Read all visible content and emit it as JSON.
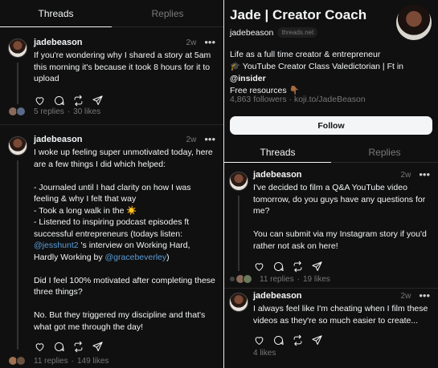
{
  "left_panel": {
    "tabs": [
      {
        "label": "Threads",
        "active": true
      },
      {
        "label": "Replies",
        "active": false
      }
    ],
    "posts": [
      {
        "username": "jadebeason",
        "time": "2w",
        "text": "If you're wondering why I shared a story at 5am this morning it's because it took 8 hours for it to upload",
        "replies": "5 replies",
        "likes": "30 likes"
      },
      {
        "username": "jadebeason",
        "time": "2w",
        "text_lines": {
          "l1": "I woke up feeling super unmotivated today, here are a few things I did which helped:",
          "l2": "- Journaled until I had clarity on how I was feeling & why I felt that way",
          "l3": "- Took a long walk in the ☀️",
          "l4": "- Listened to inspiring podcast episodes ft successful entrepreneurs (todays listen: ",
          "m1": "@jesshunt2",
          "l5": " 's interview on Working Hard, Hardly Working by ",
          "m2": "@gracebeverley",
          "l6": ")",
          "l7": "Did I feel 100% motivated after completing these three things?",
          "l8": "No. But they triggered my discipline and that's what got me through the day!"
        },
        "replies": "11 replies",
        "likes": "149 likes"
      }
    ],
    "stat_separator": "·"
  },
  "right_panel": {
    "profile": {
      "name": "Jade | Creator Coach",
      "handle": "jadebeason",
      "badge": "threads.net",
      "bio_line1": "Life as a full time creator & entrepreneur",
      "bio_line2_prefix": "🎓 YouTube Creator Class Valedictorian | Ft in ",
      "bio_mention": "@insider",
      "bio_line3": "Free resources 👇🏾",
      "followers": "4,863 followers · koji.to/JadeBeason",
      "follow_label": "Follow"
    },
    "tabs": [
      {
        "label": "Threads",
        "active": true
      },
      {
        "label": "Replies",
        "active": false
      }
    ],
    "posts": [
      {
        "username": "jadebeason",
        "time": "2w",
        "text": "I've decided to film a Q&A YouTube video tomorrow, do you guys have any questions for me?\n\nYou can submit via my Instagram story if you'd rather not ask on here!",
        "replies": "11 replies",
        "likes": "19 likes"
      },
      {
        "username": "jadebeason",
        "time": "2w",
        "text": "I always feel like I'm cheating when I film these videos as they're so much easier to create...",
        "likes": "4 likes"
      }
    ]
  },
  "icons": [
    "heart-icon",
    "comment-icon",
    "repost-icon",
    "share-icon",
    "more-icon"
  ],
  "colors": {
    "background": "#101010",
    "text": "#f3f5f7",
    "muted": "#777777",
    "mention": "#5b9dd9",
    "button": "#f3f5f7"
  }
}
